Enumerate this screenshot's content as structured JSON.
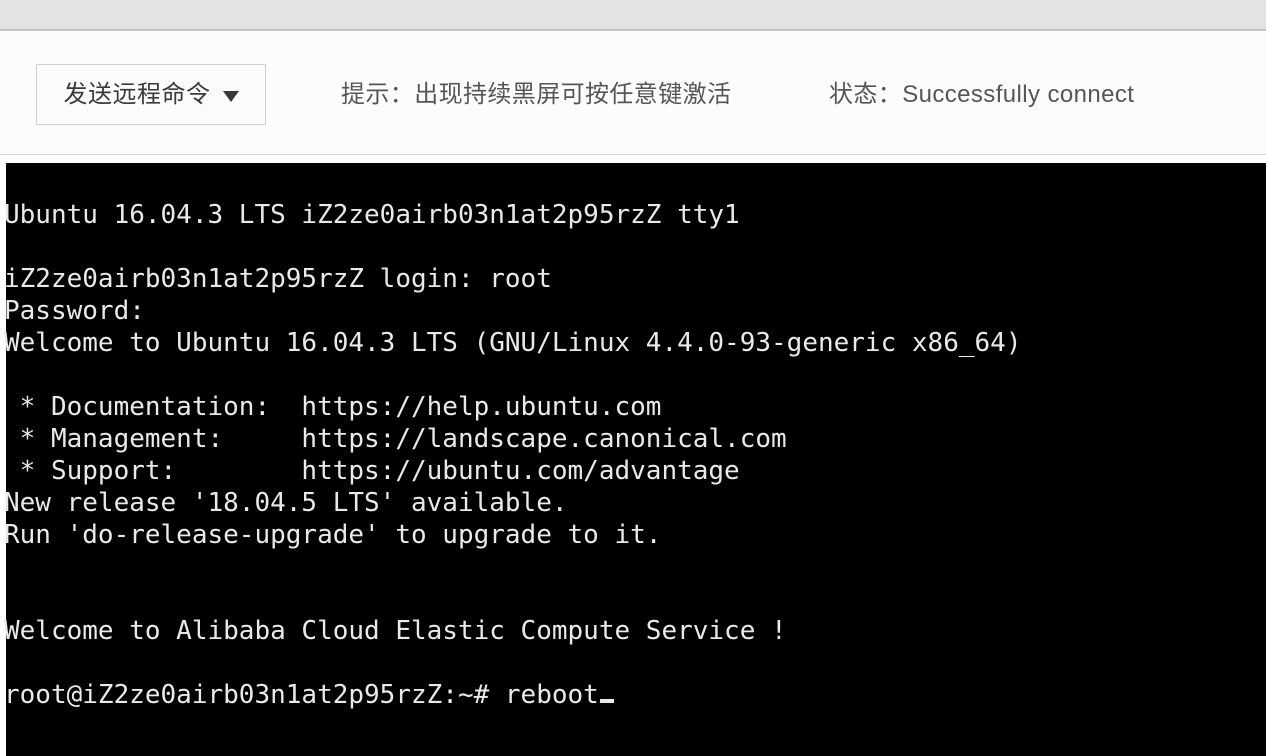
{
  "toolbar": {
    "send_command_button": "发送远程命令",
    "caret_icon": "chevron-down-icon",
    "hint": "提示：出现持续黑屏可按任意键激活",
    "status": "状态：Successfully connect",
    "colors": {
      "strip_bg": "#e3e3e4",
      "toolbar_bg": "#fcfcfd",
      "button_border": "#cfcfd2",
      "text": "#55555a"
    }
  },
  "terminal": {
    "background": "#000000",
    "foreground": "#e9e9e9",
    "hostname": "iZ2ze0airb03n1at2p95rzZ",
    "user": "root",
    "prompt": "root@iZ2ze0airb03n1at2p95rzZ:~#",
    "typed_command": "reboot",
    "cursor": "underscore-block",
    "lines": [
      "Ubuntu 16.04.3 LTS iZ2ze0airb03n1at2p95rzZ tty1",
      "",
      "iZ2ze0airb03n1at2p95rzZ login: root",
      "Password:",
      "Welcome to Ubuntu 16.04.3 LTS (GNU/Linux 4.4.0-93-generic x86_64)",
      "",
      " * Documentation:  https://help.ubuntu.com",
      " * Management:     https://landscape.canonical.com",
      " * Support:        https://ubuntu.com/advantage",
      "New release '18.04.5 LTS' available.",
      "Run 'do-release-upgrade' to upgrade to it.",
      "",
      "",
      "Welcome to Alibaba Cloud Elastic Compute Service !",
      "",
      "root@iZ2ze0airb03n1at2p95rzZ:~# reboot"
    ]
  }
}
